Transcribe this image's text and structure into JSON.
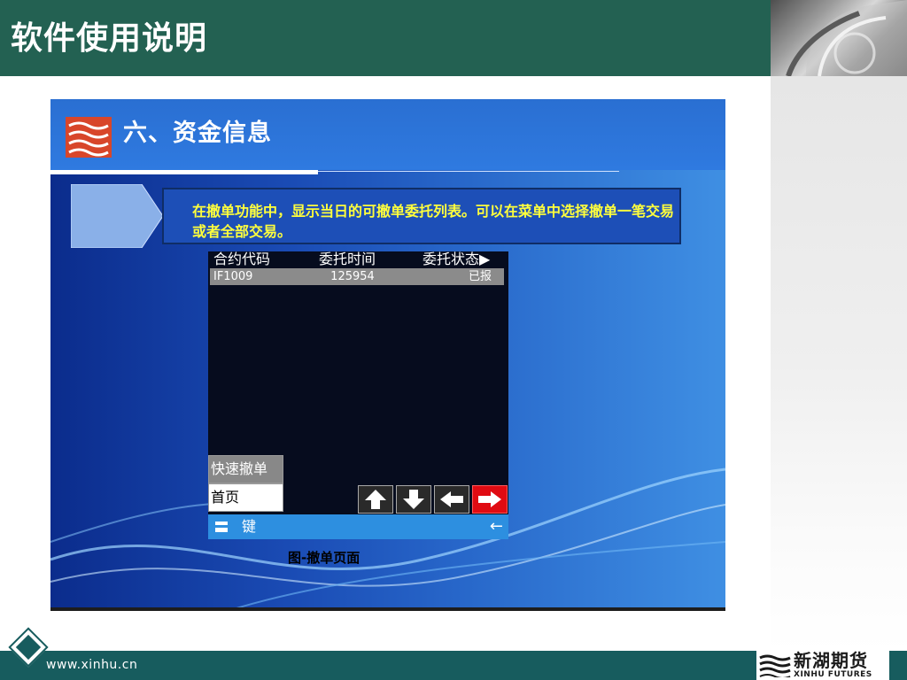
{
  "header": {
    "title": "软件使用说明"
  },
  "slide": {
    "heading": "六、资金信息",
    "note": "在撤单功能中，显示当日的可撤单委托列表。可以在菜单中选择撤单一笔交易或者全部交易。",
    "caption": "图-撤单页面"
  },
  "phone": {
    "columns": [
      "合约代码",
      "委托时间",
      "委托状态"
    ],
    "rows": [
      {
        "code": "IF1009",
        "time": "125954",
        "status": "已报"
      }
    ],
    "menu": [
      {
        "label": "快速撤单",
        "selected": true
      },
      {
        "label": "首页",
        "selected": false
      }
    ],
    "softkey_label": "键",
    "back_glyph": "←"
  },
  "footer": {
    "url": "www.xinhu.cn",
    "logo_cn": "新湖期货",
    "logo_en": "XINHU FUTURES"
  },
  "colors": {
    "header_bg": "#236152",
    "footer_bg": "#175c5e",
    "note_text": "#ffff3c",
    "active_nav": "#e00b12"
  }
}
